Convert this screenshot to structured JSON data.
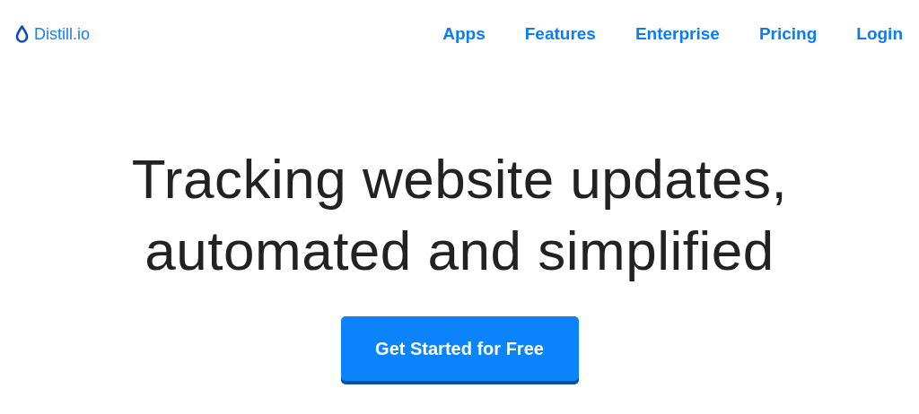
{
  "logo": {
    "text": "Distill.io"
  },
  "nav": [
    {
      "label": "Apps"
    },
    {
      "label": "Features"
    },
    {
      "label": "Enterprise"
    },
    {
      "label": "Pricing"
    },
    {
      "label": "Login"
    }
  ],
  "headline": [
    "Tracking website updates,",
    "automated and simplified"
  ],
  "cta": {
    "label": "Get Started for Free"
  }
}
